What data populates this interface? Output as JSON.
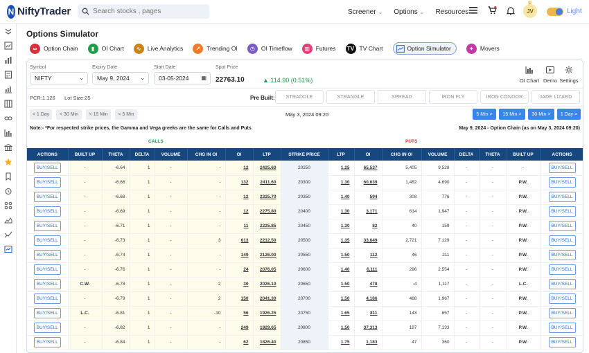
{
  "brand": {
    "name": "NiftyTrader"
  },
  "search": {
    "placeholder": "Search stocks , pages"
  },
  "topnav": [
    {
      "label": "Screener"
    },
    {
      "label": "Options"
    },
    {
      "label": "Resources"
    }
  ],
  "user": {
    "initials": "JV"
  },
  "theme": {
    "label": "Light"
  },
  "page": {
    "title": "Options Simulator"
  },
  "tabs": [
    {
      "label": "Option Chain",
      "color": "#d6303b"
    },
    {
      "label": "OI Chart",
      "color": "#1f9d4b"
    },
    {
      "label": "Live Analytics",
      "color": "#c9851a"
    },
    {
      "label": "Trending OI",
      "color": "#f07a2a"
    },
    {
      "label": "OI Timeflow",
      "color": "#7b5cc4"
    },
    {
      "label": "Futures",
      "color": "#e0407a"
    },
    {
      "label": "TV Chart",
      "color": "#111111"
    },
    {
      "label": "Option Simulator",
      "color": "#3a6fc4"
    },
    {
      "label": "Movers",
      "color": "#c23aa8"
    }
  ],
  "controls": {
    "symbol": {
      "label": "Symbol",
      "value": "NIFTY"
    },
    "expiry": {
      "label": "Expiry Date",
      "value": "May 9, 2024"
    },
    "start": {
      "label": "Start Date",
      "value": "03-05-2024"
    },
    "spot": {
      "label": "Spot Price",
      "value": "22763.10",
      "change": "▲ 114.90 (0.51%)"
    }
  },
  "tools": [
    {
      "label": "OI Chart",
      "icon": "bar-chart-icon"
    },
    {
      "label": "Demo",
      "icon": "play-icon"
    },
    {
      "label": "Settings",
      "icon": "gear-icon"
    }
  ],
  "pcr": "PCR:1.126",
  "lot": "Lot Size:25",
  "prebuilt": {
    "label": "Pre Built:",
    "items": [
      "STRADDLE",
      "STRANGLE",
      "SPREAD",
      "IRON FLY",
      "IRON CONDOR",
      "JADE LIZARD"
    ]
  },
  "timeBack": [
    "< 1 Day",
    "< 30 Min",
    "< 15 Min",
    "< 5 Min"
  ],
  "currentTime": "May 3, 2024 09:20",
  "timeFwd": [
    "5 Min >",
    "15 Min >",
    "30 Min >",
    "1 Day >"
  ],
  "note": "Note:- *For respected strike prices, the Gamma and Vega greeks are the same for Calls and Puts",
  "chainInfo": "May 9, 2024 - Option Chain (as on May 3, 2024 09:20)",
  "callsLabel": "CALLS",
  "putsLabel": "PUTS",
  "headers": [
    "ACTIONS",
    "BUILT UP",
    "THETA",
    "DELTA",
    "VOLUME",
    "CHG IN OI",
    "OI",
    "LTP",
    "STRIKE PRICE",
    "LTP",
    "OI",
    "CHG IN OI",
    "VOLUME",
    "DELTA",
    "THETA",
    "BUILT UP",
    "ACTIONS"
  ],
  "buySellLabel": "BUY/SELL",
  "rows": [
    {
      "cBuilt": "-",
      "cTheta": "-6.64",
      "cDelta": "1",
      "cVol": "-",
      "cChg": "-",
      "cOI": "12",
      "cLTP": "2425.60",
      "strike": "20250",
      "pLTP": "1.25",
      "pOI": "65,537",
      "pChg": "5,405",
      "pVol": "9,528",
      "pDelta": "-",
      "pTheta": "-",
      "pBuilt": "-"
    },
    {
      "cBuilt": "-",
      "cTheta": "-6.66",
      "cDelta": "1",
      "cVol": "-",
      "cChg": "-",
      "cOI": "132",
      "cLTP": "2411.60",
      "strike": "20300",
      "pLTP": "1.30",
      "pOI": "60,639",
      "pChg": "1,482",
      "pVol": "4,690",
      "pDelta": "-",
      "pTheta": "-",
      "pBuilt": "P.W."
    },
    {
      "cBuilt": "-",
      "cTheta": "-6.68",
      "cDelta": "1",
      "cVol": "-",
      "cChg": "-",
      "cOI": "12",
      "cLTP": "2325.70",
      "strike": "20350",
      "pLTP": "1.40",
      "pOI": "594",
      "pChg": "308",
      "pVol": "776",
      "pDelta": "-",
      "pTheta": "-",
      "pBuilt": "P.W."
    },
    {
      "cBuilt": "-",
      "cTheta": "-6.69",
      "cDelta": "1",
      "cVol": "-",
      "cChg": "-",
      "cOI": "12",
      "cLTP": "2275.80",
      "strike": "20400",
      "pLTP": "1.30",
      "pOI": "3,171",
      "pChg": "614",
      "pVol": "1,947",
      "pDelta": "-",
      "pTheta": "-",
      "pBuilt": "P.W."
    },
    {
      "cBuilt": "-",
      "cTheta": "-6.71",
      "cDelta": "1",
      "cVol": "-",
      "cChg": "-",
      "cOI": "11",
      "cLTP": "2225.85",
      "strike": "20450",
      "pLTP": "1.30",
      "pOI": "82",
      "pChg": "40",
      "pVol": "159",
      "pDelta": "-",
      "pTheta": "-",
      "pBuilt": "P.W."
    },
    {
      "cBuilt": "-",
      "cTheta": "-6.73",
      "cDelta": "1",
      "cVol": "-",
      "cChg": "3",
      "cOI": "613",
      "cLTP": "2212.50",
      "strike": "20500",
      "pLTP": "1.35",
      "pOI": "33,649",
      "pChg": "2,721",
      "pVol": "7,129",
      "pDelta": "-",
      "pTheta": "-",
      "pBuilt": "P.W."
    },
    {
      "cBuilt": "-",
      "cTheta": "-6.74",
      "cDelta": "1",
      "cVol": "-",
      "cChg": "-",
      "cOI": "149",
      "cLTP": "2126.00",
      "strike": "20550",
      "pLTP": "1.50",
      "pOI": "112",
      "pChg": "46",
      "pVol": "211",
      "pDelta": "-",
      "pTheta": "-",
      "pBuilt": "P.W."
    },
    {
      "cBuilt": "-",
      "cTheta": "-6.76",
      "cDelta": "1",
      "cVol": "-",
      "cChg": "-",
      "cOI": "24",
      "cLTP": "2076.05",
      "strike": "20600",
      "pLTP": "1.40",
      "pOI": "6,111",
      "pChg": "296",
      "pVol": "2,554",
      "pDelta": "-",
      "pTheta": "-",
      "pBuilt": "P.W."
    },
    {
      "cBuilt": "C.W.",
      "cTheta": "-6.78",
      "cDelta": "1",
      "cVol": "-",
      "cChg": "2",
      "cOI": "30",
      "cLTP": "2026.10",
      "strike": "20650",
      "pLTP": "1.50",
      "pOI": "478",
      "pChg": "-4",
      "pVol": "1,117",
      "pDelta": "-",
      "pTheta": "-",
      "pBuilt": "L.C."
    },
    {
      "cBuilt": "-",
      "cTheta": "-6.79",
      "cDelta": "1",
      "cVol": "-",
      "cChg": "2",
      "cOI": "150",
      "cLTP": "2041.30",
      "strike": "20700",
      "pLTP": "1.50",
      "pOI": "4,166",
      "pChg": "488",
      "pVol": "1,967",
      "pDelta": "-",
      "pTheta": "-",
      "pBuilt": "P.W."
    },
    {
      "cBuilt": "L.C.",
      "cTheta": "-6.81",
      "cDelta": "1",
      "cVol": "-",
      "cChg": "-10",
      "cOI": "56",
      "cLTP": "1926.25",
      "strike": "20750",
      "pLTP": "1.65",
      "pOI": "811",
      "pChg": "143",
      "pVol": "657",
      "pDelta": "-",
      "pTheta": "-",
      "pBuilt": "P.W."
    },
    {
      "cBuilt": "-",
      "cTheta": "-6.82",
      "cDelta": "1",
      "cVol": "-",
      "cChg": "-",
      "cOI": "249",
      "cLTP": "1929.65",
      "strike": "20800",
      "pLTP": "1.50",
      "pOI": "37,313",
      "pChg": "187",
      "pVol": "7,133",
      "pDelta": "-",
      "pTheta": "-",
      "pBuilt": "P.W."
    },
    {
      "cBuilt": "-",
      "cTheta": "-6.84",
      "cDelta": "1",
      "cVol": "-",
      "cChg": "-",
      "cOI": "62",
      "cLTP": "1826.40",
      "strike": "20850",
      "pLTP": "1.75",
      "pOI": "1,183",
      "pChg": "47",
      "pVol": "360",
      "pDelta": "-",
      "pTheta": "-",
      "pBuilt": "P.W."
    }
  ]
}
